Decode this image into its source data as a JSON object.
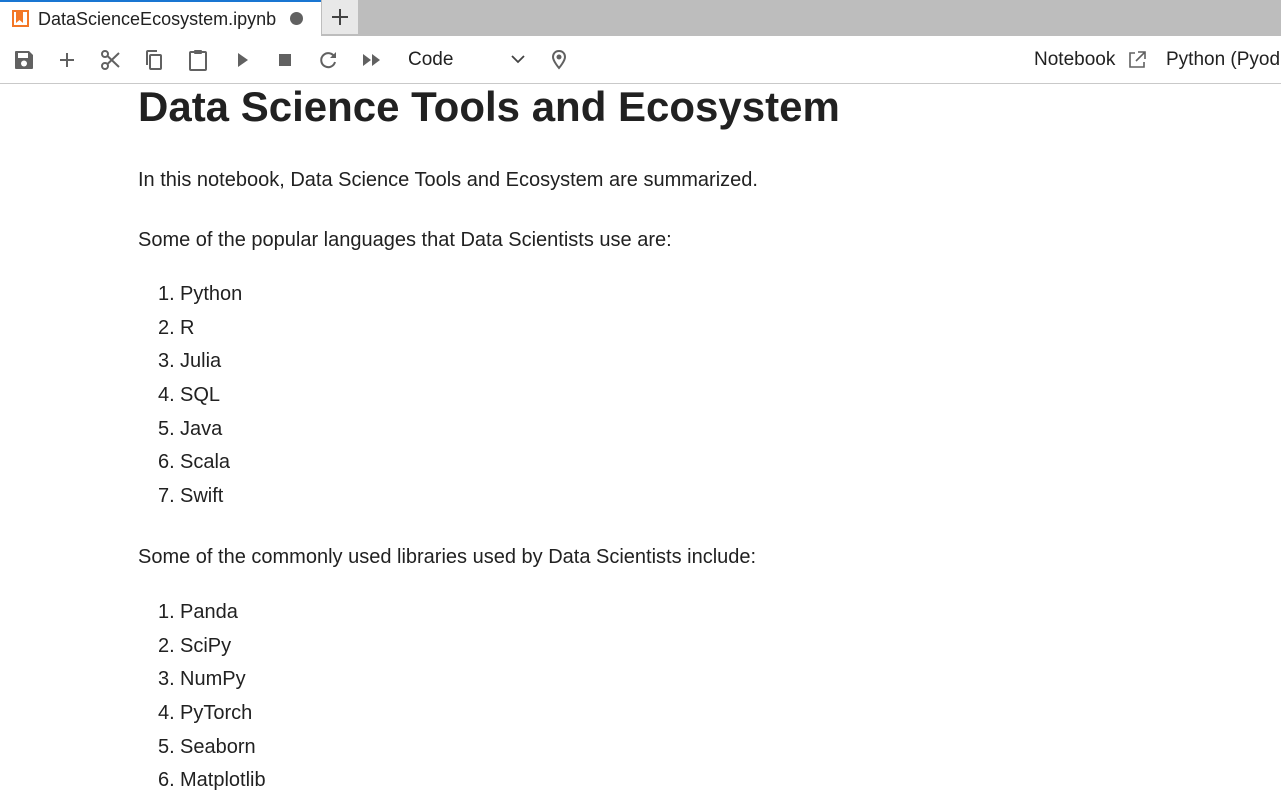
{
  "tabbar": {
    "active_tab_title": "DataScienceEcosystem.ipynb",
    "new_tab_symbol": "+"
  },
  "toolbar": {
    "cell_type": "Code",
    "notebook_link": "Notebook",
    "kernel": "Python (Pyod"
  },
  "notebook": {
    "heading": "Data Science Tools and Ecosystem",
    "intro": "In this notebook, Data Science Tools and Ecosystem are summarized.",
    "languages_intro": "Some of the popular languages that Data Scientists use are:",
    "languages": [
      {
        "num": "1.",
        "name": "Python"
      },
      {
        "num": "2.",
        "name": "R"
      },
      {
        "num": "3.",
        "name": "Julia"
      },
      {
        "num": "4.",
        "name": "SQL"
      },
      {
        "num": "5.",
        "name": "Java"
      },
      {
        "num": "6.",
        "name": "Scala"
      },
      {
        "num": "7.",
        "name": "Swift"
      }
    ],
    "libraries_intro": "Some of the commonly used libraries used by Data Scientists include:",
    "libraries": [
      {
        "num": "1.",
        "name": "Panda"
      },
      {
        "num": "2.",
        "name": "SciPy"
      },
      {
        "num": "3.",
        "name": "NumPy"
      },
      {
        "num": "4.",
        "name": "PyTorch"
      },
      {
        "num": "5.",
        "name": "Seaborn"
      },
      {
        "num": "6.",
        "name": "Matplotlib"
      }
    ]
  },
  "colors": {
    "notebook_icon": "#f37726",
    "tab_accent": "#1976d2",
    "icon_gray": "#616161",
    "tabbar_bg": "#bdbdbd"
  },
  "icons": {
    "tab": "notebook-icon",
    "save": "save-icon",
    "insert": "plus-icon",
    "cut": "scissors-icon",
    "copy": "copy-icon",
    "paste": "clipboard-icon",
    "run": "play-icon",
    "interrupt": "stop-icon",
    "restart": "refresh-icon",
    "run_all": "fast-forward-icon",
    "cell_type_dropdown": "chevron-down-icon",
    "debugger": "bug-icon",
    "open_notebook": "external-link-icon"
  }
}
